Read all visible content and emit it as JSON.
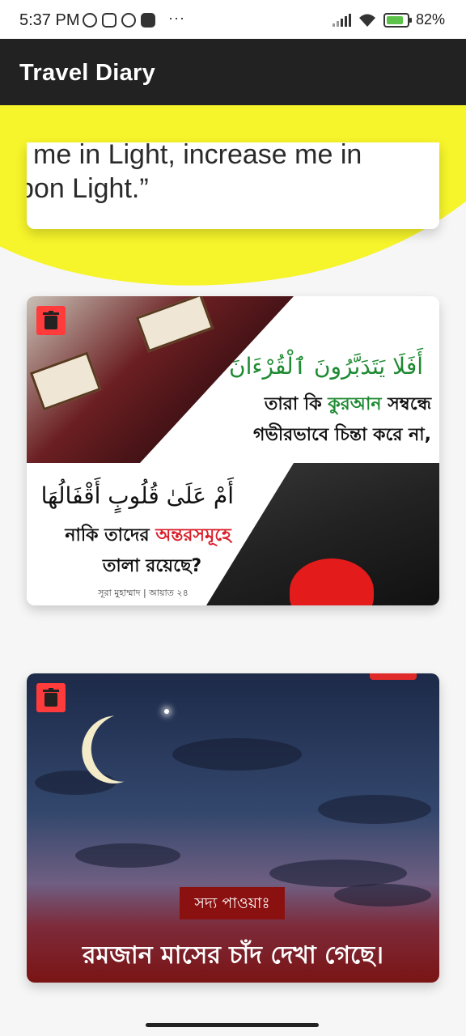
{
  "status_bar": {
    "time": "5:37 PM",
    "battery": "82%",
    "more": "···",
    "icons": [
      "alarm-icon",
      "app-icon",
      "settings-icon",
      "youtube-icon",
      "signal-icon",
      "wifi-icon",
      "battery-icon"
    ]
  },
  "appbar": {
    "title": "Travel Diary"
  },
  "cards": [
    {
      "quote_line1": "me in Light, increase me in",
      "quote_line2": "pon Light.”"
    },
    {
      "arabic_top": "أَفَلَا يَتَدَبَّرُونَ ٱلْقُرْءَانَ",
      "bangla_top_1a": "তারা কি ",
      "bangla_top_1b": "কুরআন",
      "bangla_top_1c": " সম্বন্ধে",
      "bangla_top_2": "গভীরভাবে চিন্তা করে না,",
      "arabic_bottom": "أَمْ عَلَىٰ قُلُوبٍ أَقْفَالُهَا",
      "bangla_bottom_1a": "নাকি তাদের ",
      "bangla_bottom_1b": "অন্তরসমূহে",
      "bangla_bottom_2": "তালা রয়েছে?",
      "citation": "সূরা মুহাম্মাদ | আয়াত ২৪"
    },
    {
      "label": "সদ্য পাওয়াঃ",
      "headline": "রমজান মাসের চাঁদ দেখা গেছে।"
    }
  ],
  "colors": {
    "appbar": "#222222",
    "accent_yellow": "#f6f42a",
    "delete_red": "#ff3b3b"
  }
}
